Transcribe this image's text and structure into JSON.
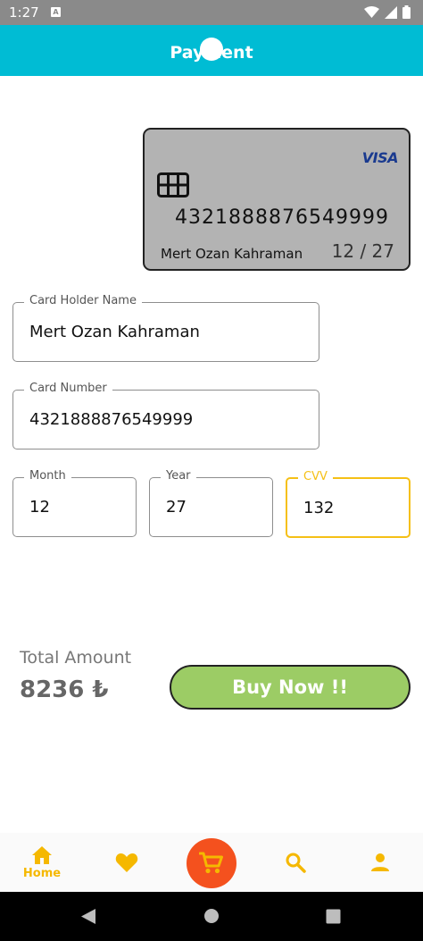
{
  "status_bar": {
    "time": "1:27",
    "notif_letter": "A"
  },
  "header": {
    "title": "Payment"
  },
  "card": {
    "brand": "VISA",
    "number": "4321888876549999",
    "holder": "Mert Ozan Kahraman",
    "expiry": "12 / 27"
  },
  "form": {
    "holder": {
      "label": "Card Holder Name",
      "value": "Mert Ozan Kahraman"
    },
    "number": {
      "label": "Card Number",
      "value": "4321888876549999"
    },
    "month": {
      "label": "Month",
      "value": "12"
    },
    "year": {
      "label": "Year",
      "value": "27"
    },
    "cvv": {
      "label": "CVV",
      "value": "132"
    }
  },
  "total": {
    "label": "Total Amount",
    "value": "8236 ₺"
  },
  "buy_label": "Buy Now !!",
  "nav": {
    "home_label": "Home"
  },
  "colors": {
    "header": "#00bcd4",
    "accent": "#f5b800",
    "buy_button": "#9ccc65",
    "cart_fab": "#f4511e",
    "focused_border": "#f5c016"
  }
}
